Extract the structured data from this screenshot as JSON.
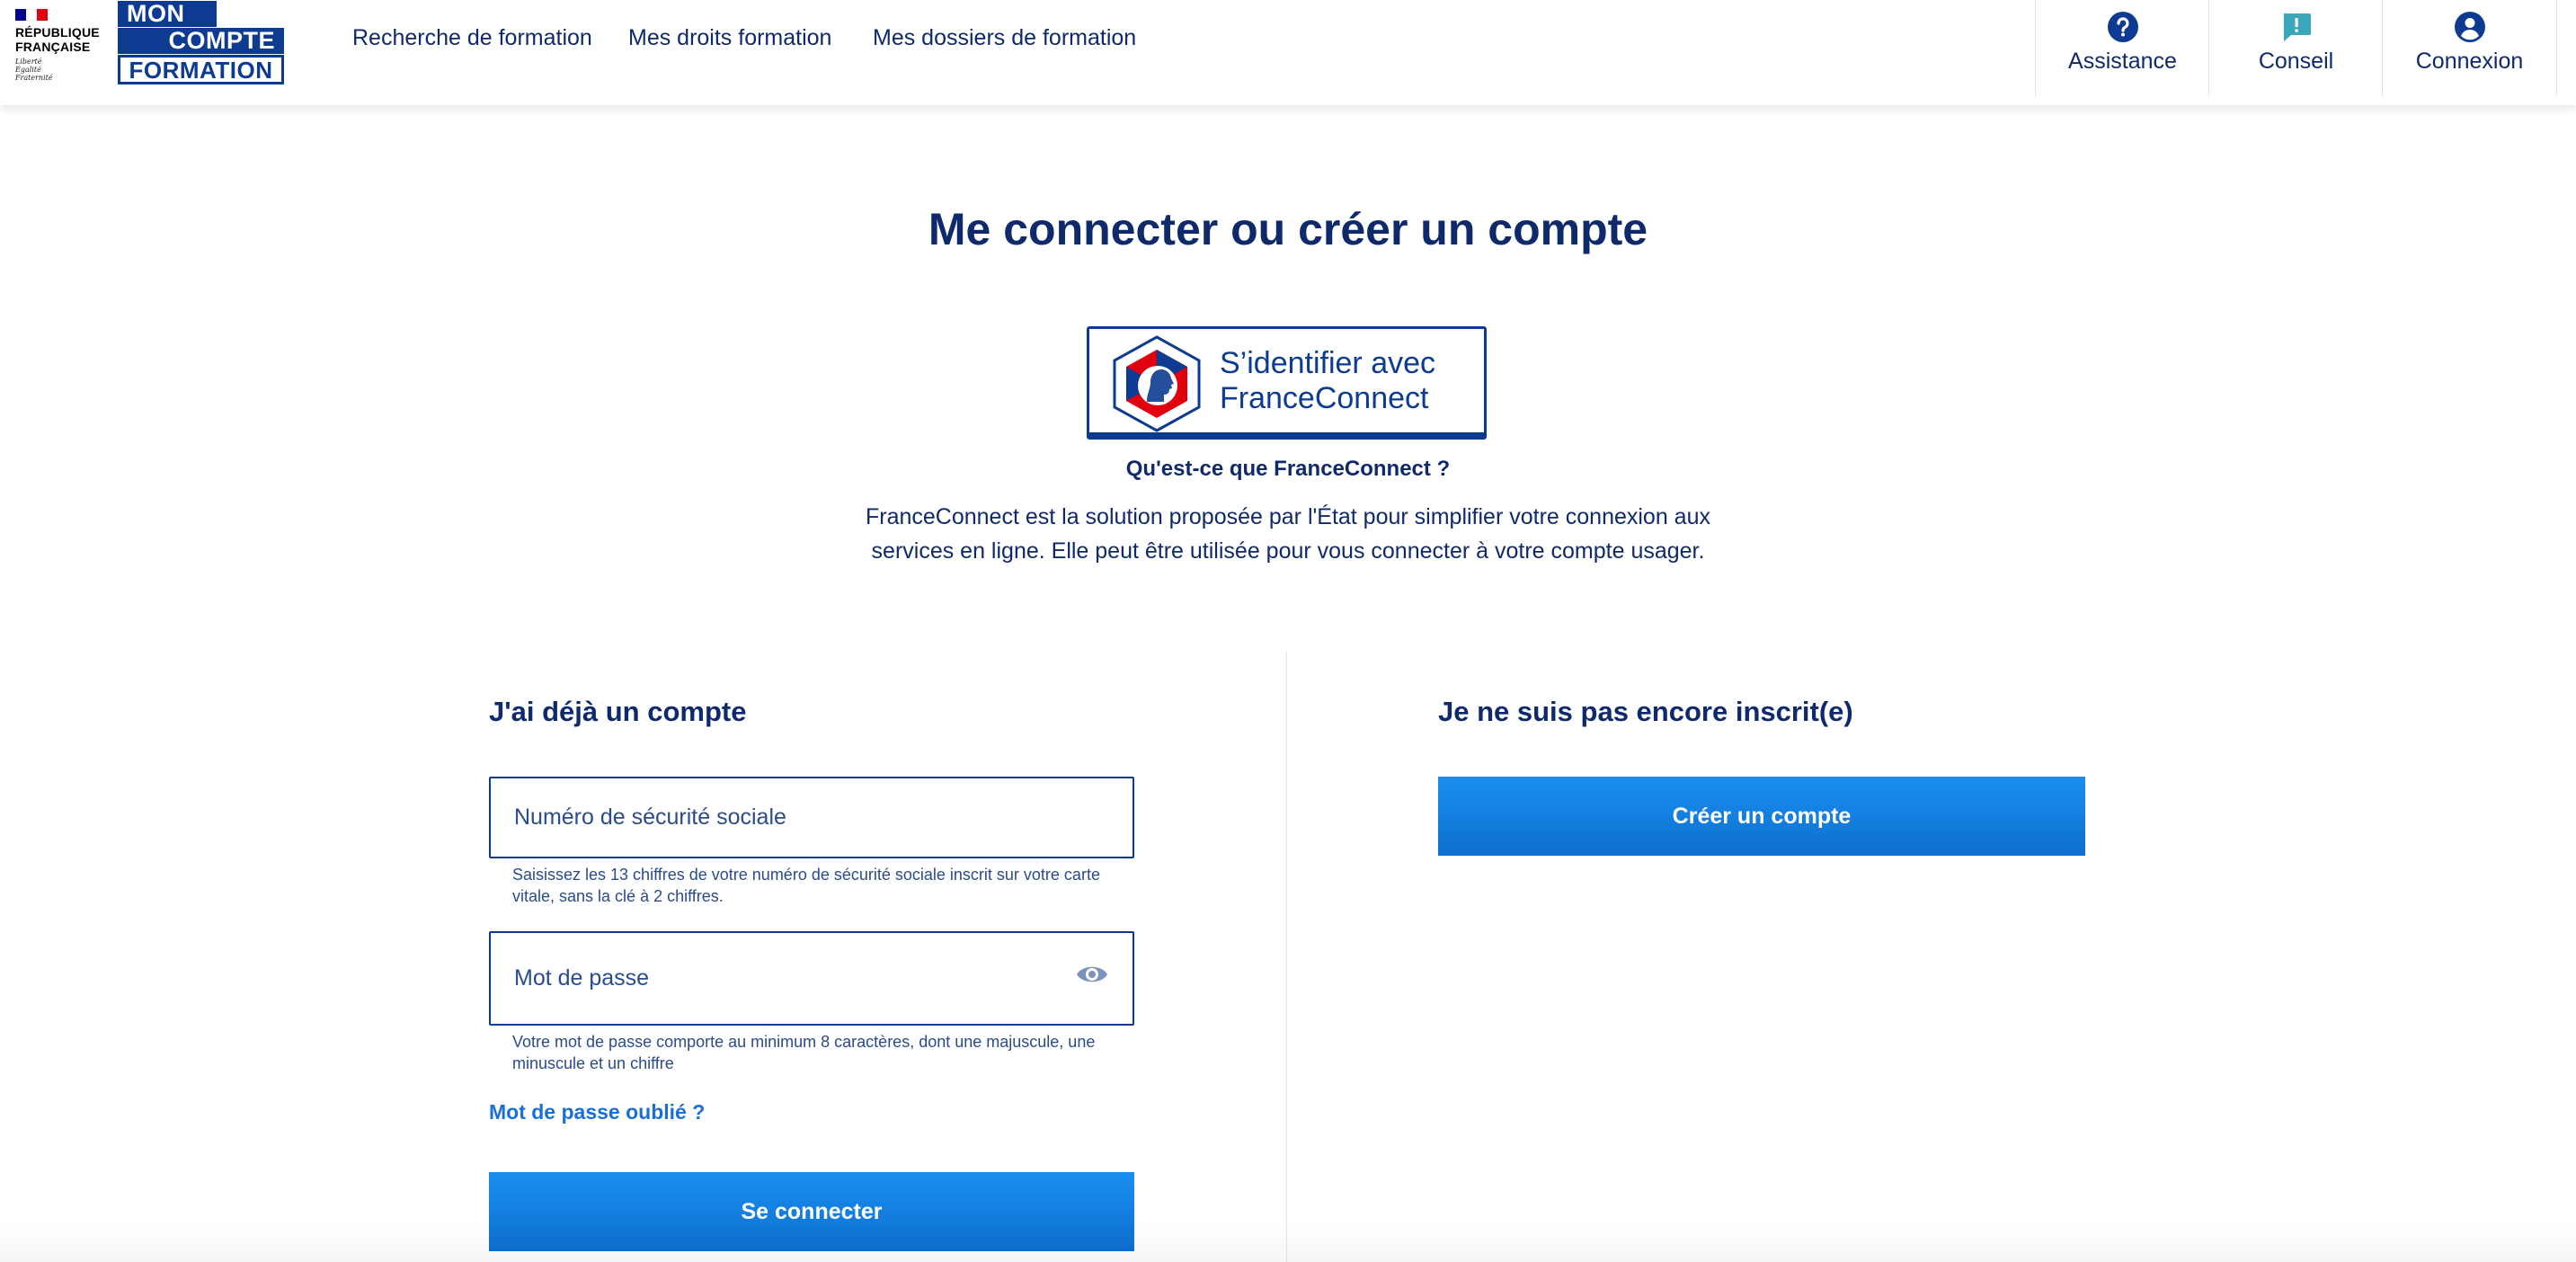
{
  "header": {
    "republique": [
      "RÉPUBLIQUE",
      "FRANÇAISE"
    ],
    "motto": [
      "Liberté",
      "Égalité",
      "Fraternité"
    ],
    "logo": {
      "line1": "MON",
      "line2": "COMPTE",
      "line3": "FORMATION"
    },
    "nav": [
      {
        "label": "Recherche de formation"
      },
      {
        "label": "Mes droits formation"
      },
      {
        "label": "Mes dossiers de formation"
      }
    ],
    "actions": [
      {
        "label": "Assistance",
        "icon": "help-circle-icon"
      },
      {
        "label": "Conseil",
        "icon": "chat-alert-icon"
      },
      {
        "label": "Connexion",
        "icon": "user-circle-icon"
      }
    ]
  },
  "main": {
    "title": "Me connecter ou créer un compte",
    "franceconnect": {
      "button_line1": "S’identifier avec",
      "button_line2": "FranceConnect",
      "question": "Qu'est-ce que FranceConnect ?",
      "description_line1": "FranceConnect est la solution proposée par l'État pour simplifier votre connexion aux",
      "description_line2": "services en ligne. Elle peut être utilisée pour vous connecter à votre compte usager."
    },
    "login": {
      "title": "J'ai déjà un compte",
      "ssn_placeholder": "Numéro de sécurité sociale",
      "ssn_value": "",
      "ssn_help_line1": "Saisissez les 13 chiffres de votre numéro de sécurité sociale inscrit sur votre carte",
      "ssn_help_line2": "vitale, sans la clé à 2 chiffres.",
      "password_placeholder": "Mot de passe",
      "password_value": "",
      "password_help_line1": "Votre mot de passe comporte au minimum 8 caractères, dont une majuscule, une",
      "password_help_line2": "minuscule et un chiffre",
      "forgot_link": "Mot de passe oublié ?",
      "submit_label": "Se connecter"
    },
    "signup": {
      "title": "Je ne suis pas encore inscrit(e)",
      "button_label": "Créer un compte"
    }
  },
  "colors": {
    "navy": "#0f2a6b",
    "brand_blue": "#0d3b91",
    "button_blue": "#1a8ff0",
    "link_blue": "#1a6fd6",
    "conseil_teal": "#3aa6b9",
    "flag_blue": "#000091",
    "flag_red": "#e1000f"
  }
}
